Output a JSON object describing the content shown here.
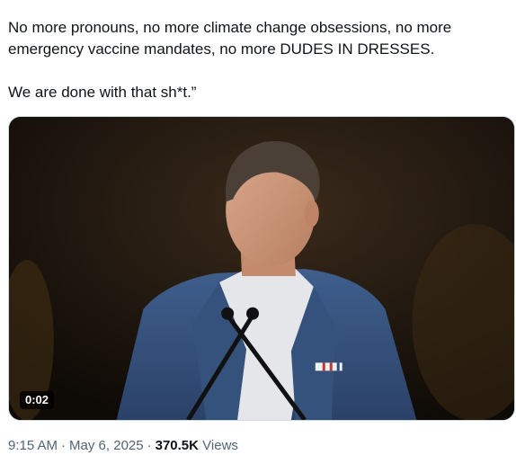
{
  "tweet": {
    "text_lines": [
      "No more pronouns, no more climate change obsessions, no more emergency vaccine mandates, no more DUDES IN DRESSES.",
      "We are done with that sh*t.”"
    ],
    "media": {
      "type": "video",
      "duration": "0:02"
    },
    "meta": {
      "time": "9:15 AM",
      "separator": "·",
      "date": "May 6, 2025",
      "views_count": "370.5K",
      "views_label": "Views"
    }
  },
  "colors": {
    "text": "#0f1419",
    "secondary_text": "#536471",
    "media_border": "#cfd9de"
  }
}
